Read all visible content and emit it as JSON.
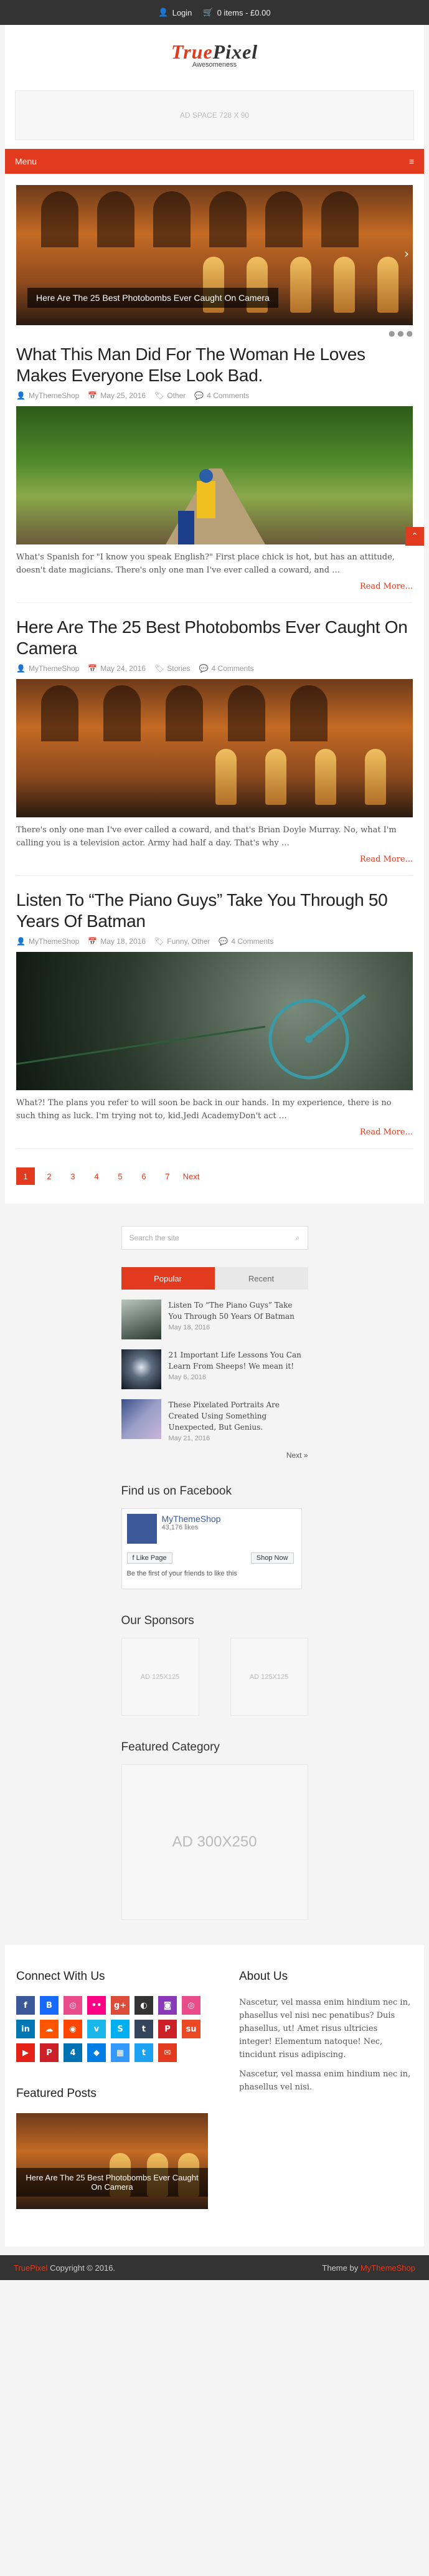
{
  "topbar": {
    "login": "Login",
    "cart": "0 items - £0.00"
  },
  "site": {
    "logo_a": "True",
    "logo_b": "Pixel",
    "tagline": "Awesomeness"
  },
  "ad_top": "AD SPACE 728 X 90",
  "nav": {
    "menu": "Menu"
  },
  "slider": {
    "caption": "Here Are The 25 Best Photobombs Ever Caught On Camera"
  },
  "posts": [
    {
      "title": "What This Man Did For The Woman He Loves Makes Everyone Else Look Bad.",
      "author": "MyThemeShop",
      "date": "May 25, 2016",
      "cat": "Other",
      "comments": "4 Comments",
      "excerpt": "What's Spanish for \"I know you speak English?\" First place chick is hot, but has an attitude, doesn't date magicians. There's only one man I've ever called a coward, and …",
      "more": "Read More..."
    },
    {
      "title": "Here Are The 25 Best Photobombs Ever Caught On Camera",
      "author": "MyThemeShop",
      "date": "May 24, 2016",
      "cat": "Stories",
      "comments": "4 Comments",
      "excerpt": "There's only one man I've ever called a coward, and that's Brian Doyle Murray. No, what I'm calling you is a television actor. Army had half a day. That's why …",
      "more": "Read More..."
    },
    {
      "title": "Listen To “The Piano Guys” Take You Through 50 Years Of Batman",
      "author": "MyThemeShop",
      "date": "May 18, 2016",
      "cat": "Funny, Other",
      "comments": "4 Comments",
      "excerpt": "What?! The plans you refer to will soon be back in our hands. In my experience, there is no such thing as luck. I'm trying not to, kid.Jedi AcademyDon't act …",
      "more": "Read More..."
    }
  ],
  "pager": {
    "p1": "1",
    "p2": "2",
    "p3": "3",
    "p4": "4",
    "p5": "5",
    "p6": "6",
    "p7": "7",
    "next": "Next"
  },
  "sidebar": {
    "search_placeholder": "Search the site",
    "tab_popular": "Popular",
    "tab_recent": "Recent",
    "popular": [
      {
        "title": "Listen To “The Piano Guys” Take You Through 50 Years Of Batman",
        "date": "May 18, 2016"
      },
      {
        "title": "21 Important Life Lessons You Can Learn From Sheeps! We mean it!",
        "date": "May 6, 2016"
      },
      {
        "title": "These Pixelated Portraits Are Created Using Something Unexpected, But Genius.",
        "date": "May 21, 2016"
      }
    ],
    "next": "Next »",
    "fb_title": "Find us on Facebook",
    "fb_name": "MyThemeShop",
    "fb_likes": "43,176 likes",
    "fb_like": "Like Page",
    "fb_shop": "Shop Now",
    "fb_friends": "Be the first of your friends to like this",
    "sponsors_title": "Our Sponsors",
    "sponsor_1": "AD 125X125",
    "sponsor_2": "AD 125X125",
    "featured_title": "Featured Category",
    "ad_300": "AD 300X250"
  },
  "footer": {
    "connect_title": "Connect With Us",
    "about_title": "About Us",
    "about_1": "Nascetur, vel massa enim hindium nec in, phasellus vel nisi nec penatibus? Duis phasellus, ut! Amet risus ultricies integer! Elementum natoque! Nec, tincidunt risus adipiscing.",
    "about_2": "Nascetur, vel massa enim hindium nec in, phasellus vel nisi.",
    "featured_title": "Featured Posts",
    "featured_caption": "Here Are The 25 Best Photobombs Ever Caught On Camera"
  },
  "copyright": {
    "brand": "TruePixel",
    "text": "Copyright © 2016.",
    "theme_by": "Theme by",
    "theme_link": "MyThemeShop"
  },
  "colors": {
    "accent": "#e23a1e",
    "topbar": "#333333"
  },
  "social_icons": [
    "facebook-icon",
    "behance-icon",
    "dribbble-icon",
    "flickr-icon",
    "google-plus-icon",
    "github-icon",
    "instagram-icon",
    "dribbble-icon",
    "linkedin-icon",
    "soundcloud-icon",
    "reddit-icon",
    "vimeo-icon",
    "skype-icon",
    "tumblr-icon",
    "pinterest-icon",
    "stumbleupon-icon",
    "youtube-icon",
    "pinterest-icon",
    "foursquare-icon",
    "dropbox-icon",
    "delicious-icon",
    "twitter-icon",
    "email-icon"
  ]
}
